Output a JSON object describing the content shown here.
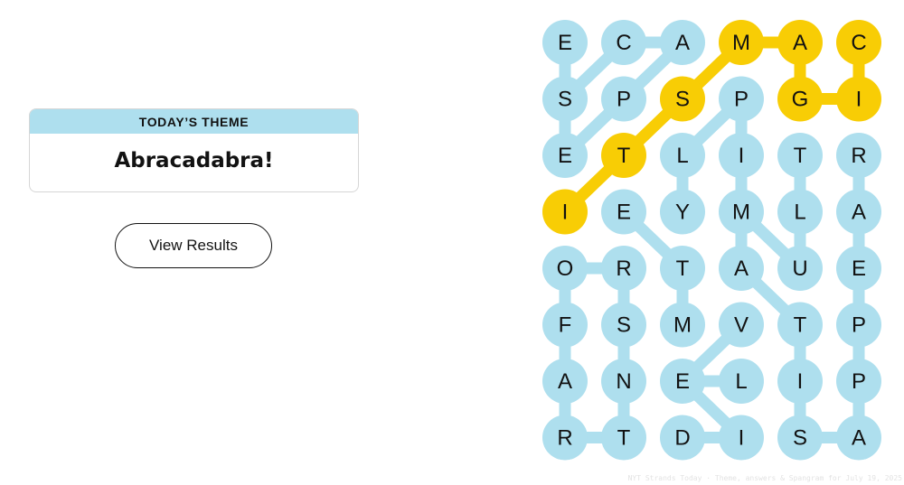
{
  "theme": {
    "heading": "TODAY’S THEME",
    "title": "Abracadabra!"
  },
  "results_button": {
    "label": "View Results"
  },
  "colors": {
    "found": "#aedfee",
    "spangram": "#f8cd05",
    "text": "#121212"
  },
  "board": {
    "rows": [
      [
        "E",
        "C",
        "A",
        "M",
        "A",
        "C"
      ],
      [
        "S",
        "P",
        "S",
        "P",
        "G",
        "I"
      ],
      [
        "E",
        "T",
        "L",
        "I",
        "T",
        "R"
      ],
      [
        "I",
        "E",
        "Y",
        "M",
        "L",
        "A"
      ],
      [
        "O",
        "R",
        "T",
        "A",
        "U",
        "E"
      ],
      [
        "F",
        "S",
        "M",
        "V",
        "T",
        "P"
      ],
      [
        "A",
        "N",
        "E",
        "L",
        "I",
        "P"
      ],
      [
        "R",
        "T",
        "D",
        "I",
        "S",
        "A"
      ]
    ],
    "spangram_cells": [
      [
        3,
        0
      ],
      [
        2,
        1
      ],
      [
        1,
        2
      ],
      [
        0,
        3
      ],
      [
        0,
        4
      ],
      [
        1,
        4
      ],
      [
        1,
        5
      ],
      [
        0,
        5
      ]
    ],
    "word_paths": [
      [
        [
          3,
          0
        ],
        [
          2,
          1
        ],
        [
          1,
          2
        ],
        [
          0,
          3
        ],
        [
          0,
          4
        ],
        [
          1,
          4
        ],
        [
          1,
          5
        ],
        [
          0,
          5
        ]
      ],
      [
        [
          0,
          0
        ],
        [
          1,
          0
        ],
        [
          2,
          0
        ]
      ],
      [
        [
          0,
          2
        ],
        [
          0,
          1
        ],
        [
          1,
          0
        ]
      ],
      [
        [
          0,
          2
        ],
        [
          1,
          1
        ],
        [
          2,
          0
        ]
      ],
      [
        [
          1,
          3
        ],
        [
          2,
          2
        ],
        [
          3,
          2
        ]
      ],
      [
        [
          2,
          3
        ],
        [
          3,
          3
        ],
        [
          4,
          4
        ]
      ],
      [
        [
          2,
          3
        ],
        [
          1,
          3
        ]
      ],
      [
        [
          2,
          4
        ],
        [
          3,
          4
        ],
        [
          4,
          4
        ]
      ],
      [
        [
          2,
          5
        ],
        [
          3,
          5
        ],
        [
          4,
          5
        ],
        [
          5,
          5
        ],
        [
          6,
          5
        ],
        [
          7,
          5
        ]
      ],
      [
        [
          3,
          1
        ],
        [
          4,
          2
        ],
        [
          5,
          2
        ]
      ],
      [
        [
          3,
          3
        ],
        [
          4,
          3
        ],
        [
          5,
          4
        ],
        [
          6,
          4
        ],
        [
          7,
          4
        ]
      ],
      [
        [
          4,
          0
        ],
        [
          4,
          1
        ],
        [
          5,
          1
        ],
        [
          6,
          1
        ],
        [
          7,
          1
        ],
        [
          7,
          0
        ],
        [
          6,
          0
        ],
        [
          5,
          0
        ],
        [
          4,
          0
        ]
      ],
      [
        [
          4,
          0
        ],
        [
          5,
          0
        ]
      ],
      [
        [
          5,
          3
        ],
        [
          6,
          2
        ],
        [
          7,
          3
        ]
      ],
      [
        [
          6,
          2
        ],
        [
          6,
          3
        ]
      ],
      [
        [
          7,
          2
        ],
        [
          7,
          3
        ]
      ],
      [
        [
          7,
          4
        ],
        [
          7,
          5
        ]
      ],
      [
        [
          4,
          1
        ],
        [
          5,
          1
        ],
        [
          6,
          1
        ]
      ]
    ]
  },
  "watermark": "NYT Strands Today · Theme, answers & Spangram for July 19, 2025"
}
